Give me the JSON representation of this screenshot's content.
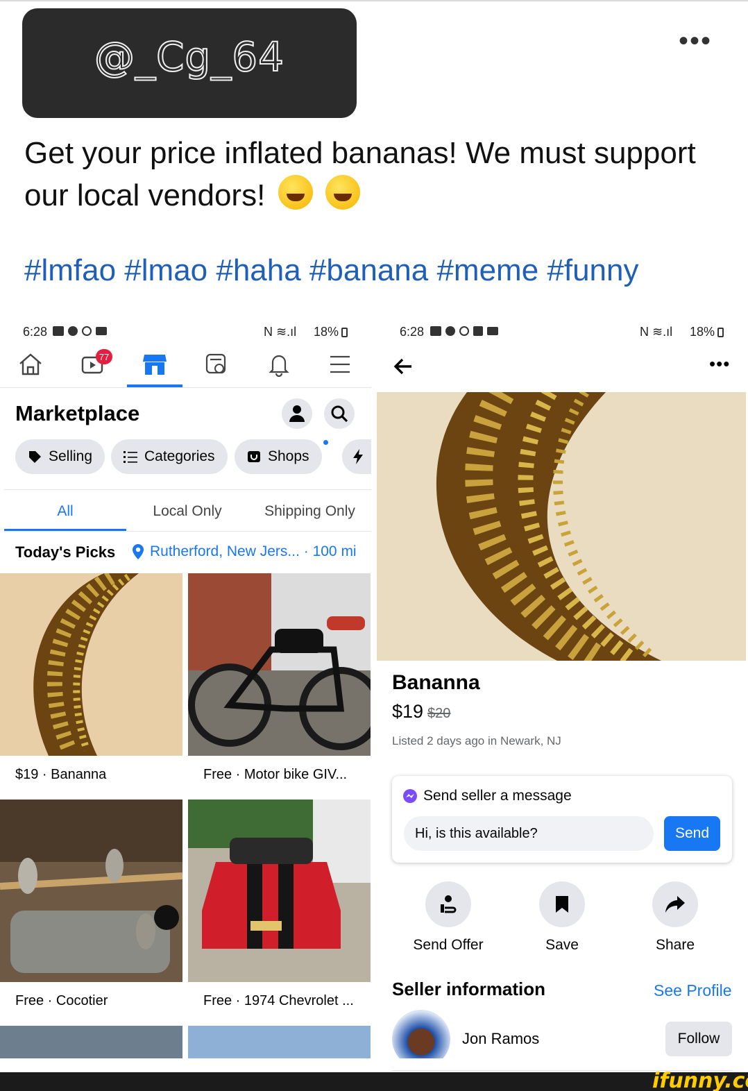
{
  "post": {
    "handle": "@_Cg_64",
    "text_line1": "Get your price inflated bananas! We must support",
    "text_line2": "our local vendors!",
    "emojis": [
      "rolling-on-floor-laughing-emoji",
      "grinning-sweat-emoji"
    ],
    "hashtags": "#lmfao #lmao #haha #banana #meme #funny"
  },
  "left_screen": {
    "status_time": "6:28",
    "status_battery": "18%",
    "notification_badge": "77",
    "title": "Marketplace",
    "chips": [
      {
        "label": "Selling",
        "icon": "tag-icon"
      },
      {
        "label": "Categories",
        "icon": "list-icon"
      },
      {
        "label": "Shops",
        "icon": "shop-icon"
      }
    ],
    "tabs": [
      "All",
      "Local Only",
      "Shipping Only"
    ],
    "active_tab": "All",
    "picks_title": "Today's Picks",
    "location": "Rutherford, New Jers... · 100 mi",
    "items": [
      {
        "caption": "$19 · Bananna"
      },
      {
        "caption": "Free · Motor bike GIV..."
      },
      {
        "caption": "Free · Cocotier"
      },
      {
        "caption": "Free · 1974 Chevrolet ..."
      }
    ]
  },
  "right_screen": {
    "status_time": "6:28",
    "status_battery": "18%",
    "listing_title": "Bananna",
    "price": "$19",
    "original_price": "$20",
    "listed": "Listed 2 days ago in Newark, NJ",
    "message_label": "Send seller a message",
    "message_text": "Hi, is this available?",
    "send_label": "Send",
    "actions": [
      "Send Offer",
      "Save",
      "Share"
    ],
    "seller_section": "Seller information",
    "see_profile": "See Profile",
    "seller_name": "Jon Ramos",
    "follow_label": "Follow"
  },
  "watermark": "ifunny.co",
  "colors": {
    "accent": "#1877f2",
    "hashtag": "#1f5fb8",
    "chip_bg": "#e4e6eb",
    "handle_bg": "#2b2b2b"
  }
}
